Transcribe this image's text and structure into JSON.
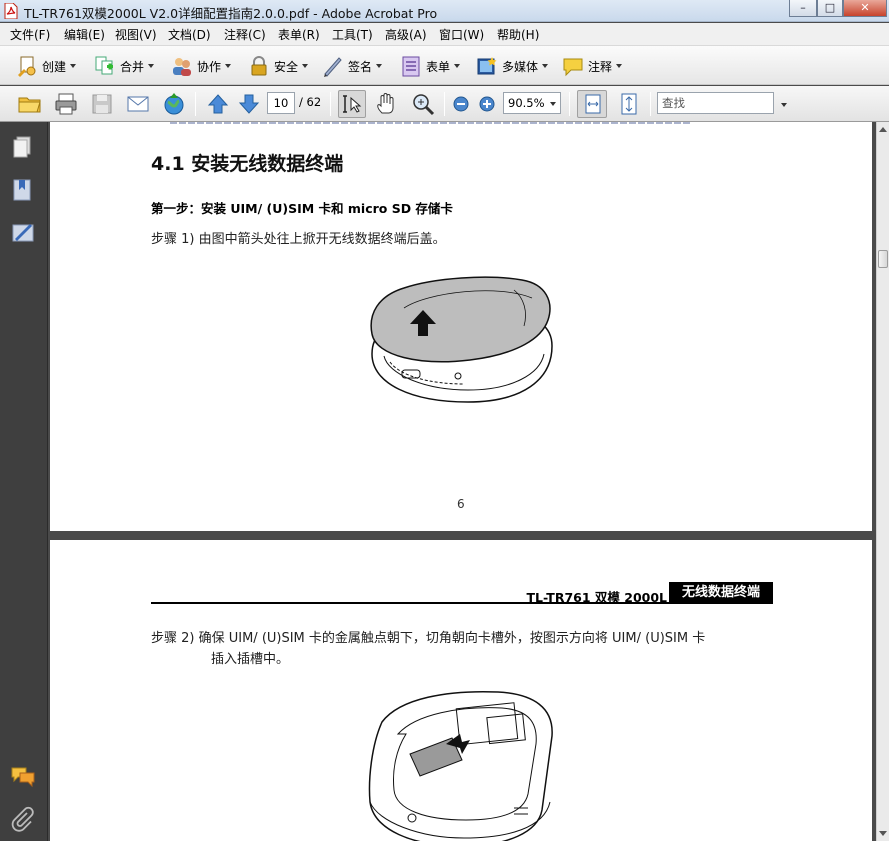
{
  "window": {
    "title": "TL-TR761双模2000L V2.0详细配置指南2.0.0.pdf - Adobe Acrobat Pro",
    "minimize": "–",
    "restore": "□",
    "close": "✕"
  },
  "menu": [
    "文件(F)",
    "编辑(E)",
    "视图(V)",
    "文档(D)",
    "注释(C)",
    "表单(R)",
    "工具(T)",
    "高级(A)",
    "窗口(W)",
    "帮助(H)"
  ],
  "toolbar": {
    "create": "创建",
    "combine": "合并",
    "collaborate": "协作",
    "secure": "安全",
    "sign": "签名",
    "forms": "表单",
    "multimedia": "多媒体",
    "comment": "注释"
  },
  "nav": {
    "page_current": "10",
    "page_total": "/ 62",
    "zoom": "90.5%",
    "find_placeholder": "查找"
  },
  "page1": {
    "heading": "4.1  安装无线数据终端",
    "step_title": "第一步：安装 UIM/ (U)SIM 卡和 micro SD 存储卡",
    "step1": "步骤 1)   由图中箭头处往上掀开无线数据终端后盖。",
    "page_number": "6"
  },
  "page2": {
    "header_product": "TL-TR761  双模  2000L",
    "header_section": "无线数据终端",
    "step2_line1": "步骤 2)   确保 UIM/ (U)SIM 卡的金属触点朝下，切角朝向卡槽外，按图示方向将 UIM/ (U)SIM 卡",
    "step2_line2": "插入插槽中。"
  },
  "colors": {
    "titlebar": "#c9d9ec",
    "panel": "#3f3f3f",
    "canvas": "#4a4a4a",
    "page": "#ffffff"
  },
  "icons": [
    "pdf-file-icon",
    "create-icon",
    "combine-icon",
    "collaborate-icon",
    "secure-lock-icon",
    "sign-pen-icon",
    "forms-icon",
    "multimedia-icon",
    "comment-icon",
    "open-folder-icon",
    "print-icon",
    "save-icon",
    "email-icon",
    "web-icon",
    "page-up-icon",
    "page-down-icon",
    "select-text-icon",
    "hand-tool-icon",
    "marquee-zoom-icon",
    "zoom-out-icon",
    "zoom-in-icon",
    "fit-width-icon",
    "fit-page-icon",
    "pages-panel-icon",
    "bookmarks-panel-icon",
    "signatures-panel-icon",
    "comments-panel-icon",
    "attachments-panel-icon"
  ]
}
